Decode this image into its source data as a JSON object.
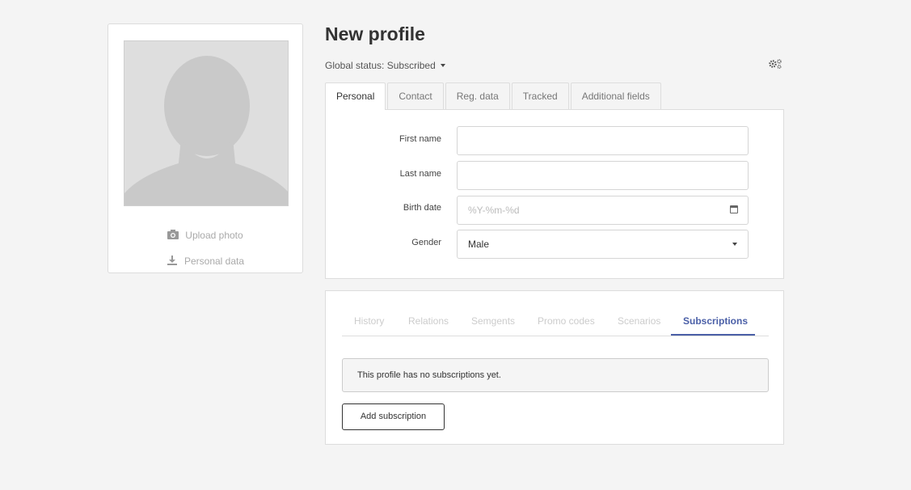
{
  "sidebar": {
    "upload_photo": "Upload photo",
    "personal_data": "Personal data"
  },
  "header": {
    "title": "New profile",
    "global_status_label": "Global status:",
    "global_status_value": "Subscribed"
  },
  "tabs": [
    "Personal",
    "Contact",
    "Reg. data",
    "Tracked",
    "Additional fields"
  ],
  "form": {
    "first_name_label": "First name",
    "first_name_value": "",
    "last_name_label": "Last name",
    "last_name_value": "",
    "birth_date_label": "Birth date",
    "birth_date_placeholder": "%Y-%m-%d",
    "gender_label": "Gender",
    "gender_value": "Male"
  },
  "subtabs": [
    "History",
    "Relations",
    "Semgents",
    "Promo codes",
    "Scenarios",
    "Subscriptions"
  ],
  "subscriptions": {
    "empty_message": "This profile has no subscriptions yet.",
    "add_button": "Add subscription"
  },
  "colors": {
    "accent": "#4a5fa7",
    "background": "#f4f4f4"
  }
}
